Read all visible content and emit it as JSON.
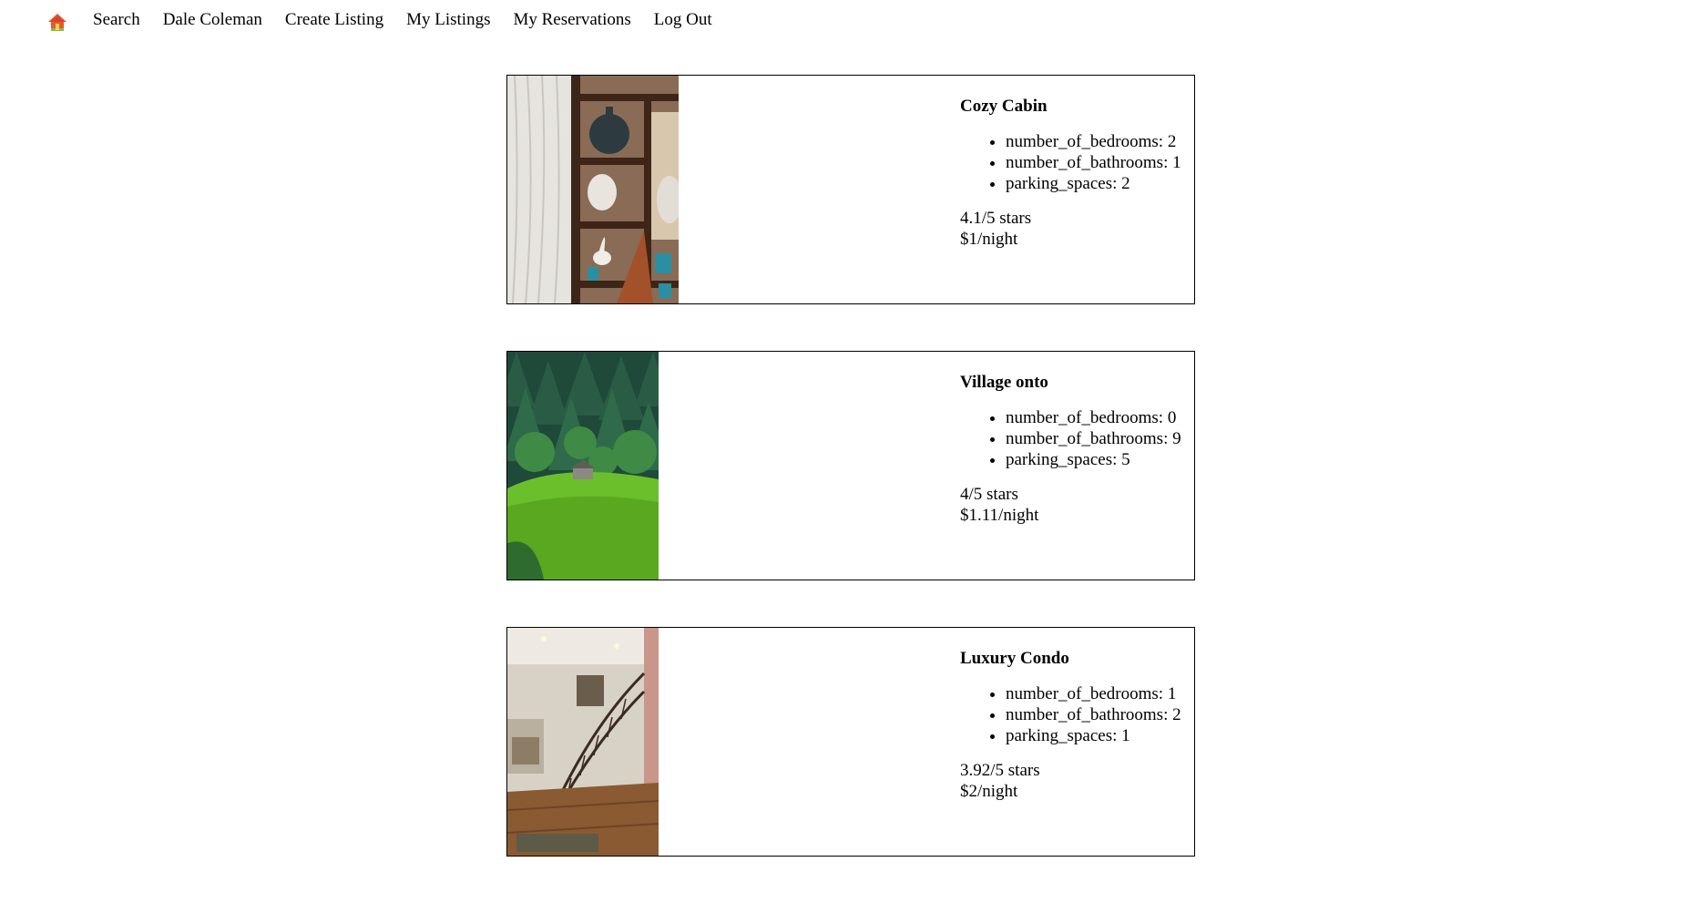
{
  "nav": {
    "home_icon": "home-icon",
    "links": [
      "Search",
      "Dale Coleman",
      "Create Listing",
      "My Listings",
      "My Reservations",
      "Log Out"
    ]
  },
  "listings": [
    {
      "title": "Cozy Cabin",
      "features": [
        "number_of_bedrooms: 2",
        "number_of_bathrooms: 1",
        "parking_spaces: 2"
      ],
      "rating": "4.1/5 stars",
      "price": "$1/night",
      "image": "interior-shelves-photo"
    },
    {
      "title": "Village onto",
      "features": [
        "number_of_bedrooms: 0",
        "number_of_bathrooms: 9",
        "parking_spaces: 5"
      ],
      "rating": "4/5 stars",
      "price": "$1.11/night",
      "image": "forest-hillside-photo"
    },
    {
      "title": "Luxury Condo",
      "features": [
        "number_of_bedrooms: 1",
        "number_of_bathrooms: 2",
        "parking_spaces: 1"
      ],
      "rating": "3.92/5 stars",
      "price": "$2/night",
      "image": "staircase-interior-photo"
    }
  ]
}
